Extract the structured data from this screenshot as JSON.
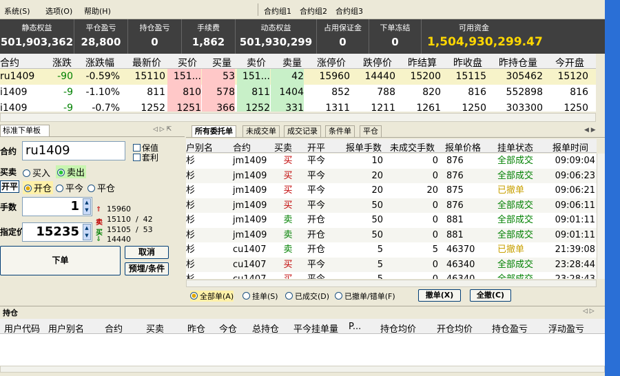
{
  "menu": [
    "系统(S)",
    "选项(O)",
    "帮助(H)",
    "合约组1",
    "合约组2",
    "合约组3"
  ],
  "summary": [
    {
      "label": "静态权益",
      "value": "501,903,362"
    },
    {
      "label": "平仓盈亏",
      "value": "28,800"
    },
    {
      "label": "持仓盈亏",
      "value": "0"
    },
    {
      "label": "手续费",
      "value": "1,862"
    },
    {
      "label": "动态权益",
      "value": "501,930,299"
    },
    {
      "label": "占用保证金",
      "value": "0"
    },
    {
      "label": "下单冻结",
      "value": "0"
    },
    {
      "label": "可用资金",
      "value": "1,504,930,299.47"
    }
  ],
  "colors": {
    "summary_bg": "#3f3f3f",
    "available_funds": "#ffd700",
    "up": "#c00000",
    "down": "#008000",
    "bid_bg": "#ffc8c8",
    "ask_bg": "#c8f0c8",
    "cancelled": "#c8a000",
    "filled": "#008000"
  },
  "quote": {
    "headers": [
      "合约",
      "涨跌",
      "涨跌幅",
      "最新价",
      "买价",
      "买量",
      "卖价",
      "卖量",
      "涨停价",
      "跌停价",
      "昨结算",
      "昨收盘",
      "昨持仓量",
      "今开盘"
    ],
    "rows": [
      [
        "ru1409",
        "-90",
        "-0.59%",
        "15110",
        "151...",
        "53",
        "151...",
        "42",
        "15960",
        "14440",
        "15200",
        "15115",
        "305462",
        "15120"
      ],
      [
        "i1409",
        "-9",
        "-1.10%",
        "811",
        "810",
        "578",
        "811",
        "1404",
        "852",
        "788",
        "820",
        "816",
        "552898",
        "816"
      ],
      [
        "i1409",
        "-9",
        "-0.7%",
        "1252",
        "1251",
        "366",
        "1252",
        "331",
        "1311",
        "1211",
        "1261",
        "1250",
        "303300",
        "1250"
      ]
    ]
  },
  "order_panel": {
    "tab": "标准下单板",
    "contract_label": "合约",
    "contract_value": "ru1409",
    "chk_hedge": "保值",
    "chk_arb": "套利",
    "side_label": "买卖",
    "buy": "买入",
    "sell": "卖出",
    "offset_label": "开平",
    "open": "开仓",
    "close_today": "平今",
    "close": "平仓",
    "qty_label": "手数",
    "qty_value": "1",
    "price_label": "指定价",
    "price_value": "15235",
    "limit_up": "15960",
    "bid_line": "15110  /  42",
    "ask_line": "15105  /  53",
    "limit_down": "14440",
    "sell_tag": "卖",
    "buy_tag": "买",
    "submit": "下单",
    "cancel": "取消",
    "preorder": "预埋/条件"
  },
  "orders": {
    "tabs": [
      "所有委托单",
      "未成交单",
      "成交记录",
      "条件单",
      "平仓"
    ],
    "headers": [
      "户别名",
      "合约",
      "买卖",
      "开平",
      "报单手数",
      "未成交手数",
      "报单价格",
      "挂单状态",
      "报单时间"
    ],
    "rows": [
      [
        "杉",
        "jm1409",
        "买",
        "平今",
        "10",
        "0",
        "876",
        "全部成交",
        "09:09:04"
      ],
      [
        "杉",
        "jm1409",
        "买",
        "平今",
        "20",
        "0",
        "876",
        "全部成交",
        "09:06:23"
      ],
      [
        "杉",
        "jm1409",
        "买",
        "平今",
        "20",
        "20",
        "875",
        "已撤单",
        "09:06:21"
      ],
      [
        "杉",
        "jm1409",
        "买",
        "平今",
        "50",
        "0",
        "876",
        "全部成交",
        "09:06:11"
      ],
      [
        "杉",
        "jm1409",
        "卖",
        "开仓",
        "50",
        "0",
        "881",
        "全部成交",
        "09:01:11"
      ],
      [
        "杉",
        "jm1409",
        "卖",
        "开仓",
        "50",
        "0",
        "881",
        "全部成交",
        "09:01:11"
      ],
      [
        "杉",
        "cu1407",
        "卖",
        "开仓",
        "5",
        "5",
        "46370",
        "已撤单",
        "21:39:08"
      ],
      [
        "杉",
        "cu1407",
        "买",
        "平今",
        "5",
        "0",
        "46340",
        "全部成交",
        "23:28:44"
      ],
      [
        "杉",
        "cu1407",
        "买",
        "平今",
        "5",
        "0",
        "46340",
        "全部成交",
        "23:28:43"
      ]
    ],
    "filters": [
      "全部单(A)",
      "挂单(S)",
      "已成交(D)",
      "已撤单/错单(F)"
    ],
    "cancel_btn": "撤单(X)",
    "cancel_all_btn": "全撤(C)"
  },
  "positions": {
    "tab": "持仓",
    "headers": [
      "用户代码",
      "用户别名",
      "合约",
      "买卖",
      "昨仓",
      "今仓",
      "总持仓",
      "平今挂单量",
      "P...",
      "持仓均价",
      "开仓均价",
      "持仓盈亏",
      "浮动盈亏"
    ]
  }
}
